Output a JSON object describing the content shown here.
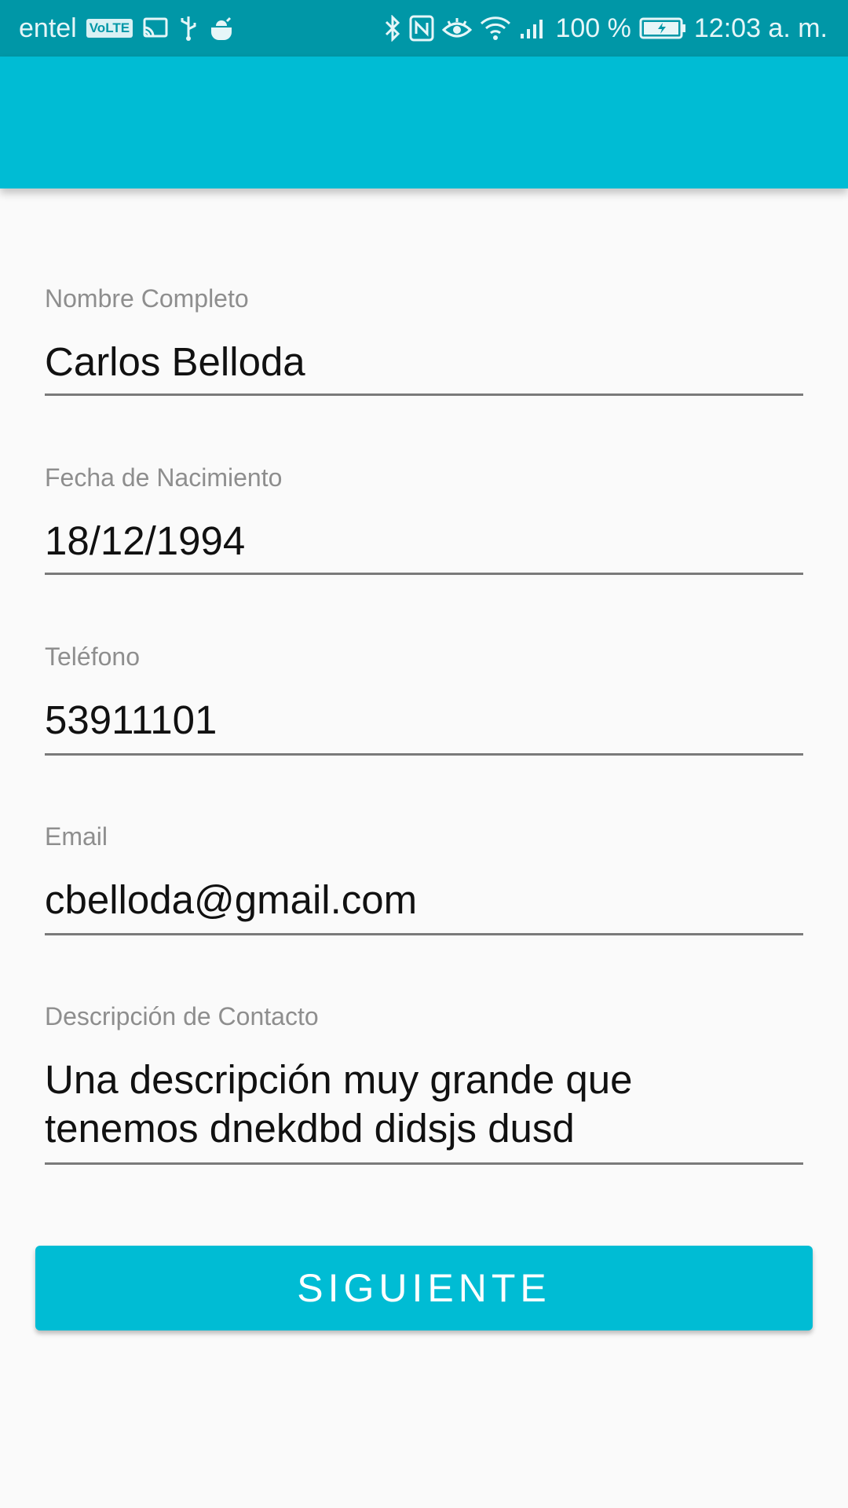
{
  "status_bar": {
    "carrier": "entel",
    "volte_badge": "VoLTE",
    "battery_percent": "100 %",
    "time": "12:03 a. m.",
    "icons": [
      "volte-icon",
      "cast-icon",
      "usb-icon",
      "android-icon",
      "bluetooth-icon",
      "nfc-icon",
      "eye-comfort-icon",
      "wifi-icon",
      "signal-icon",
      "battery-charging-icon"
    ]
  },
  "colors": {
    "status_bar": "#0097a7",
    "app_bar": "#00bcd4",
    "button": "#00bcd4",
    "background": "#fafafa",
    "label": "#8e8e8e",
    "value": "#111111"
  },
  "form": {
    "nombre": {
      "label": "Nombre Completo",
      "value": "Carlos Belloda"
    },
    "fecha": {
      "label": "Fecha de Nacimiento",
      "value": "18/12/1994"
    },
    "telefono": {
      "label": "Teléfono",
      "value": "53911101"
    },
    "email": {
      "label": "Email",
      "value": "cbelloda@gmail.com"
    },
    "descripcion": {
      "label": "Descripción de Contacto",
      "value_line1": "Una descripción muy grande que",
      "value_line2": "tenemos dnekdbd didsjs dusd"
    }
  },
  "actions": {
    "next_label": "SIGUIENTE"
  }
}
